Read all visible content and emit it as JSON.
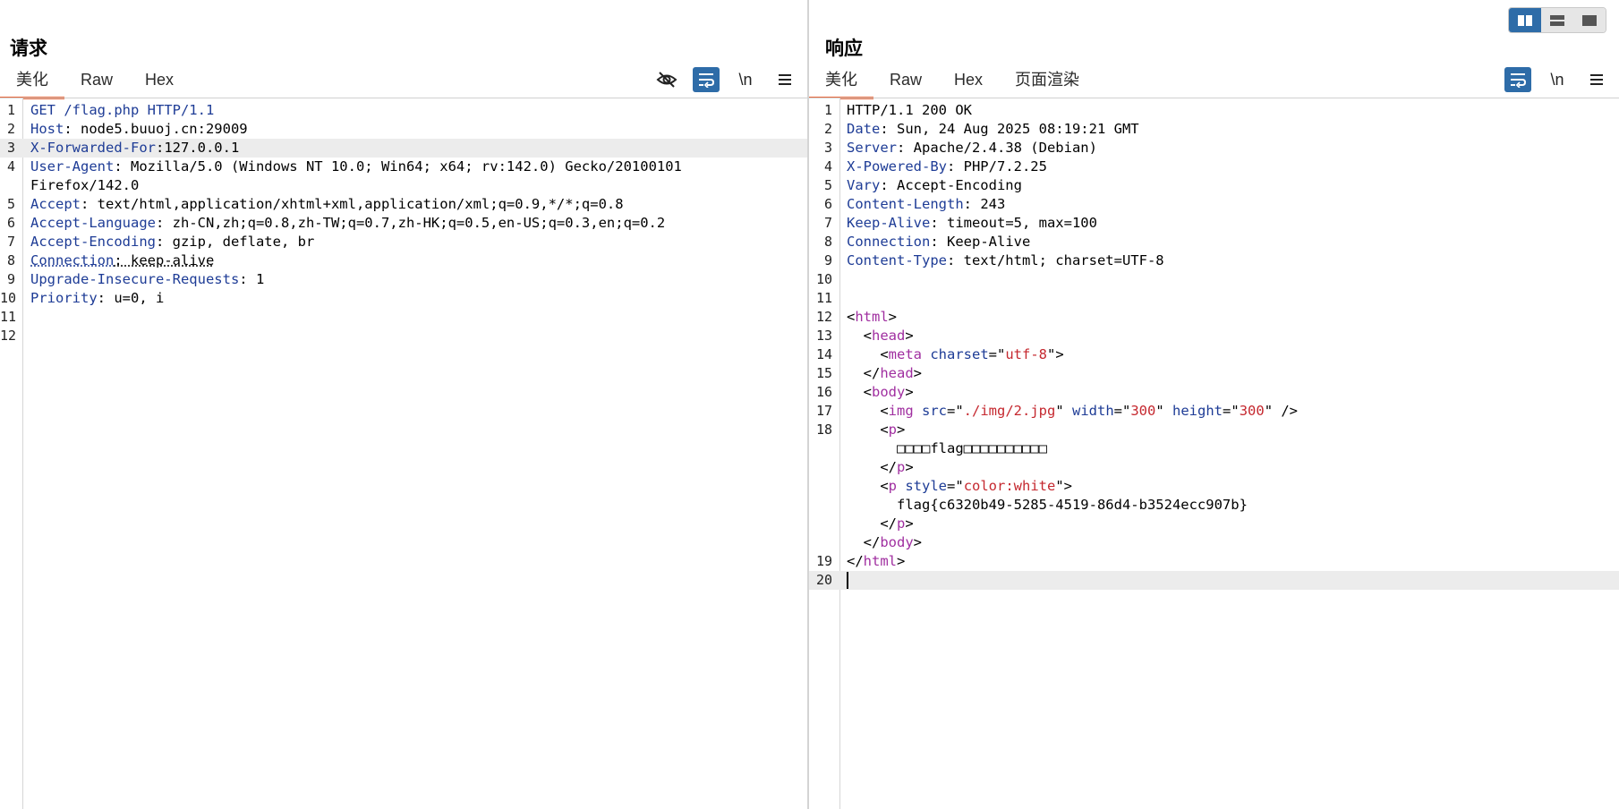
{
  "request": {
    "title": "请求",
    "tabs": [
      "美化",
      "Raw",
      "Hex"
    ],
    "active_tab": 0,
    "toolbar_icons": [
      "hide-eye-icon",
      "wrap-icon",
      "newline-icon",
      "menu-icon"
    ],
    "newline_label": "\\n",
    "lines": [
      [
        {
          "c": "k",
          "t": "GET /flag.php HTTP/1.1"
        }
      ],
      [
        {
          "c": "k",
          "t": "Host"
        },
        {
          "c": "t",
          "t": ": node5.buuoj.cn:29009"
        }
      ],
      [
        {
          "c": "k",
          "t": "X-Forwarded-For"
        },
        {
          "c": "t",
          "t": ":127.0.0.1"
        }
      ],
      [
        {
          "c": "k",
          "t": "User-Agent"
        },
        {
          "c": "t",
          "t": ": Mozilla/5.0 (Windows NT 10.0; Win64; x64; rv:142.0) Gecko/20100101"
        }
      ],
      [
        {
          "c": "t",
          "t": "Firefox/142.0"
        }
      ],
      [
        {
          "c": "k",
          "t": "Accept"
        },
        {
          "c": "t",
          "t": ": text/html,application/xhtml+xml,application/xml;q=0.9,*/*;q=0.8"
        }
      ],
      [
        {
          "c": "k",
          "t": "Accept-Language"
        },
        {
          "c": "t",
          "t": ": zh-CN,zh;q=0.8,zh-TW;q=0.7,zh-HK;q=0.5,en-US;q=0.3,en;q=0.2"
        }
      ],
      [
        {
          "c": "k",
          "t": "Accept-Encoding"
        },
        {
          "c": "t",
          "t": ": gzip, deflate, br"
        }
      ],
      [
        {
          "c": "k dot",
          "t": "Connection"
        },
        {
          "c": "t dot",
          "t": ": keep-alive"
        }
      ],
      [
        {
          "c": "k",
          "t": "Upgrade-Insecure-Requests"
        },
        {
          "c": "t",
          "t": ": 1"
        }
      ],
      [
        {
          "c": "k",
          "t": "Priority"
        },
        {
          "c": "t",
          "t": ": u=0, i"
        }
      ],
      [],
      []
    ],
    "line_numbers": [
      "1",
      "2",
      "3",
      "4",
      "",
      "5",
      "6",
      "7",
      "8",
      "9",
      "10",
      "11",
      "12"
    ]
  },
  "response": {
    "title": "响应",
    "tabs": [
      "美化",
      "Raw",
      "Hex",
      "页面渲染"
    ],
    "active_tab": 0,
    "toolbar_icons": [
      "wrap-icon",
      "newline-icon",
      "menu-icon"
    ],
    "newline_label": "\\n",
    "lines": [
      [
        {
          "c": "t",
          "t": "HTTP/1.1 200 OK"
        }
      ],
      [
        {
          "c": "k",
          "t": "Date"
        },
        {
          "c": "t",
          "t": ": Sun, 24 Aug 2025 08:19:21 GMT"
        }
      ],
      [
        {
          "c": "k",
          "t": "Server"
        },
        {
          "c": "t",
          "t": ": Apache/2.4.38 (Debian)"
        }
      ],
      [
        {
          "c": "k",
          "t": "X-Powered-By"
        },
        {
          "c": "t",
          "t": ": PHP/7.2.25"
        }
      ],
      [
        {
          "c": "k",
          "t": "Vary"
        },
        {
          "c": "t",
          "t": ": Accept-Encoding"
        }
      ],
      [
        {
          "c": "k",
          "t": "Content-Length"
        },
        {
          "c": "t",
          "t": ": 243"
        }
      ],
      [
        {
          "c": "k",
          "t": "Keep-Alive"
        },
        {
          "c": "t",
          "t": ": timeout=5, max=100"
        }
      ],
      [
        {
          "c": "k",
          "t": "Connection"
        },
        {
          "c": "t",
          "t": ": Keep-Alive"
        }
      ],
      [
        {
          "c": "k",
          "t": "Content-Type"
        },
        {
          "c": "t",
          "t": ": text/html; charset=UTF-8"
        }
      ],
      [],
      [],
      [
        {
          "c": "t",
          "t": "<"
        },
        {
          "c": "tag",
          "t": "html"
        },
        {
          "c": "t",
          "t": ">"
        }
      ],
      [
        {
          "c": "t",
          "t": "  <"
        },
        {
          "c": "tag",
          "t": "head"
        },
        {
          "c": "t",
          "t": ">"
        }
      ],
      [
        {
          "c": "t",
          "t": "    <"
        },
        {
          "c": "tag",
          "t": "meta"
        },
        {
          "c": "an",
          "t": " charset"
        },
        {
          "c": "t",
          "t": "=\""
        },
        {
          "c": "av",
          "t": "utf-8"
        },
        {
          "c": "t",
          "t": "\">"
        }
      ],
      [
        {
          "c": "t",
          "t": "  </"
        },
        {
          "c": "tag",
          "t": "head"
        },
        {
          "c": "t",
          "t": ">"
        }
      ],
      [
        {
          "c": "t",
          "t": "  <"
        },
        {
          "c": "tag",
          "t": "body"
        },
        {
          "c": "t",
          "t": ">"
        }
      ],
      [
        {
          "c": "t",
          "t": "    <"
        },
        {
          "c": "tag",
          "t": "img"
        },
        {
          "c": "an",
          "t": " src"
        },
        {
          "c": "t",
          "t": "=\""
        },
        {
          "c": "av",
          "t": "./img/2.jpg"
        },
        {
          "c": "t",
          "t": "\""
        },
        {
          "c": "an",
          "t": " width"
        },
        {
          "c": "t",
          "t": "=\""
        },
        {
          "c": "av",
          "t": "300"
        },
        {
          "c": "t",
          "t": "\""
        },
        {
          "c": "an",
          "t": " height"
        },
        {
          "c": "t",
          "t": "=\""
        },
        {
          "c": "av",
          "t": "300"
        },
        {
          "c": "t",
          "t": "\" />"
        }
      ],
      [
        {
          "c": "t",
          "t": "    <"
        },
        {
          "c": "tag",
          "t": "p"
        },
        {
          "c": "t",
          "t": ">"
        }
      ],
      [
        {
          "c": "t",
          "t": "      □□□□flag□□□□□□□□□□"
        }
      ],
      [
        {
          "c": "t",
          "t": "    </"
        },
        {
          "c": "tag",
          "t": "p"
        },
        {
          "c": "t",
          "t": ">"
        }
      ],
      [
        {
          "c": "t",
          "t": "    <"
        },
        {
          "c": "tag",
          "t": "p"
        },
        {
          "c": "an",
          "t": " style"
        },
        {
          "c": "t",
          "t": "=\""
        },
        {
          "c": "av",
          "t": "color:white"
        },
        {
          "c": "t",
          "t": "\">"
        }
      ],
      [
        {
          "c": "t",
          "t": "      flag{c6320b49-5285-4519-86d4-b3524ecc907b}"
        }
      ],
      [
        {
          "c": "t",
          "t": "    </"
        },
        {
          "c": "tag",
          "t": "p"
        },
        {
          "c": "t",
          "t": ">"
        }
      ],
      [
        {
          "c": "t",
          "t": "  </"
        },
        {
          "c": "tag",
          "t": "body"
        },
        {
          "c": "t",
          "t": ">"
        }
      ],
      [
        {
          "c": "t",
          "t": "</"
        },
        {
          "c": "tag",
          "t": "html"
        },
        {
          "c": "t",
          "t": ">"
        }
      ],
      []
    ],
    "line_numbers": [
      "1",
      "2",
      "3",
      "4",
      "5",
      "6",
      "7",
      "8",
      "9",
      "10",
      "11",
      "12",
      "13",
      "14",
      "15",
      "16",
      "17",
      "18",
      "",
      "",
      "",
      "",
      "",
      "",
      "19",
      "20"
    ]
  },
  "layout_switch": [
    "split-horizontal-icon",
    "split-vertical-icon",
    "single-pane-icon"
  ],
  "colors": {
    "accent": "#e8673b",
    "active_tool": "#2e6ca8",
    "header_key": "#1e3c96",
    "tag": "#a02fa0",
    "attr_value": "#c5282f"
  }
}
